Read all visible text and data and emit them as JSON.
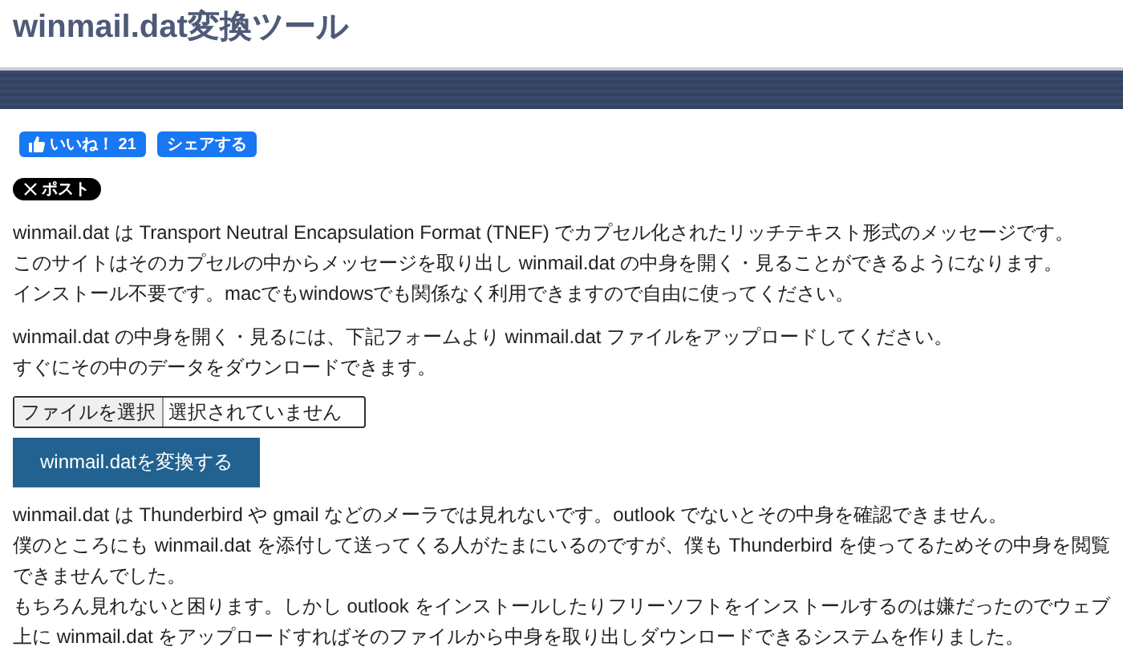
{
  "page_title": "winmail.dat変換ツール",
  "social": {
    "like_button": {
      "label": "いいね！",
      "count": "21"
    },
    "share_button": "シェアする",
    "post_button": "ポスト"
  },
  "intro_paragraphs": [
    {
      "lines": [
        "winmail.dat は Transport Neutral Encapsulation Format (TNEF) でカプセル化されたリッチテキスト形式のメッセージです。",
        "このサイトはそのカプセルの中からメッセージを取り出し winmail.dat の中身を開く・見ることができるようになります。",
        "インストール不要です。macでもwindowsでも関係なく利用できますので自由に使ってください。"
      ]
    },
    {
      "lines": [
        "winmail.dat の中身を開く・見るには、下記フォームより winmail.dat ファイルをアップロードしてください。",
        "すぐにその中のデータをダウンロードできます。"
      ]
    }
  ],
  "upload_form": {
    "file_button": "ファイルを選択",
    "file_status": "選択されていません",
    "submit_button": "winmail.datを変換する"
  },
  "about_paragraph": {
    "lines": [
      "winmail.dat は Thunderbird や gmail などのメーラでは見れないです。outlook でないとその中身を確認できません。",
      "僕のところにも winmail.dat を添付して送ってくる人がたまにいるのですが、僕も Thunderbird を使ってるためその中身を閲覧できませんでした。",
      "もちろん見れないと困ります。しかし outlook をインストールしたりフリーソフトをインストールするのは嫌だったのでウェブ上に winmail.dat をアップロードすればそのファイルから中身を取り出しダウンロードできるシステムを作りました。"
    ]
  }
}
